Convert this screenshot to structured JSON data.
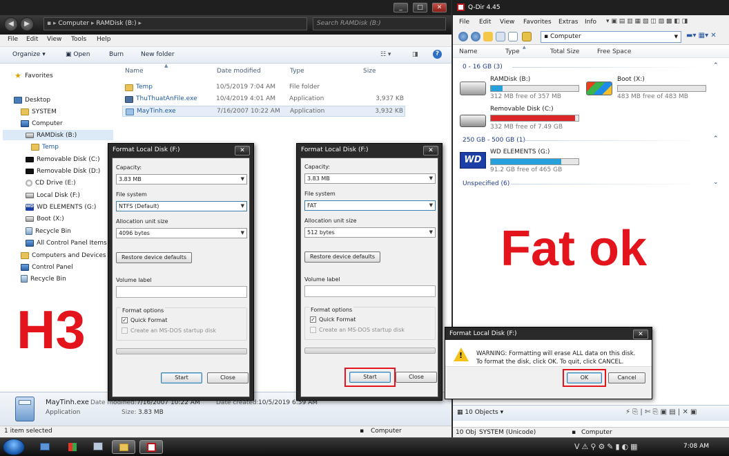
{
  "explorer": {
    "breadcrumb": [
      "Computer",
      "RAMDisk (B:)"
    ],
    "search_placeholder": "Search RAMDisk (B:)",
    "menu": [
      "File",
      "Edit",
      "View",
      "Tools",
      "Help"
    ],
    "toolbar": {
      "organize": "Organize",
      "open": "Open",
      "burn": "Burn",
      "new_folder": "New folder"
    },
    "columns": {
      "name": "Name",
      "date": "Date modified",
      "type": "Type",
      "size": "Size"
    },
    "files": [
      {
        "name": "Temp",
        "date": "10/5/2019 7:04 AM",
        "type": "File folder",
        "size": ""
      },
      {
        "name": "ThuThuatAnFile.exe",
        "date": "10/4/2019 4:01 AM",
        "type": "Application",
        "size": "3,937 KB"
      },
      {
        "name": "MayTinh.exe",
        "date": "7/16/2007 10:22 AM",
        "type": "Application",
        "size": "3,932 KB"
      }
    ],
    "nav": {
      "favorites": "Favorites",
      "desktop": "Desktop",
      "system": "SYSTEM",
      "computer": "Computer",
      "ramdisk": "RAMDisk (B:)",
      "temp": "Temp",
      "removable_c": "Removable Disk (C:)",
      "removable_d": "Removable Disk (D:)",
      "cd_drive": "CD Drive (E:)",
      "local_f": "Local Disk (F:)",
      "wd": "WD ELEMENTS (G:)",
      "boot": "Boot (X:)",
      "recycle_bin": "Recycle Bin",
      "all_cp": "All Control Panel Items",
      "computers_devices": "Computers and Devices",
      "control_panel": "Control Panel",
      "recycle_bin2": "Recycle Bin"
    },
    "details": {
      "name": "MayTinh.exe",
      "type": "Application",
      "date_modified_label": "Date modified:",
      "date_modified": "7/16/2007 10:22 AM",
      "date_created_label": "Date created:",
      "date_created": "10/5/2019 6:59 AM",
      "size_label": "Size:",
      "size": "3.83 MB"
    },
    "status_left": "1 item selected",
    "status_right": "Computer",
    "overlay_text": "H3"
  },
  "format_dialog_1": {
    "title": "Format Local Disk (F:)",
    "close": "✕",
    "capacity_label": "Capacity:",
    "capacity": "3.83 MB",
    "fs_label": "File system",
    "fs": "NTFS (Default)",
    "alloc_label": "Allocation unit size",
    "alloc": "4096 bytes",
    "restore": "Restore device defaults",
    "volume_label": "Volume label",
    "options_label": "Format options",
    "quick_format": "Quick Format",
    "msdos": "Create an MS-DOS startup disk",
    "start": "Start",
    "close_btn": "Close"
  },
  "format_dialog_2": {
    "title": "Format Local Disk (F:)",
    "close": "✕",
    "capacity_label": "Capacity:",
    "capacity": "3.83 MB",
    "fs_label": "File system",
    "fs": "FAT",
    "alloc_label": "Allocation unit size",
    "alloc": "512 bytes",
    "restore": "Restore device defaults",
    "volume_label": "Volume label",
    "options_label": "Format options",
    "quick_format": "Quick Format",
    "msdos": "Create an MS-DOS startup disk",
    "start": "Start",
    "close_btn": "Close"
  },
  "qdir": {
    "title": "Q-Dir 4.45",
    "menu": [
      "File",
      "Edit",
      "View",
      "Favorites",
      "Extras",
      "Info"
    ],
    "address": "Computer",
    "columns": {
      "name": "Name",
      "type": "Type",
      "total": "Total Size",
      "free": "Free Space"
    },
    "groups": [
      {
        "label": "0 - 16 GB (3)"
      },
      {
        "label": "250 GB - 500 GB (1)"
      },
      {
        "label": "Unspecified (6)"
      }
    ],
    "drives": [
      {
        "name": "RAMDisk (B:)",
        "free": "312 MB free of 357 MB",
        "used_fraction": 0.13,
        "bar_color": "#26a0da"
      },
      {
        "name": "Boot (X:)",
        "free": "483 MB free of 483 MB",
        "used_fraction": 0.0,
        "bar_color": "#26a0da"
      },
      {
        "name": "Removable Disk (C:)",
        "free": "332 MB free of 7.49 GB",
        "used_fraction": 0.96,
        "bar_color": "#da2626"
      },
      {
        "name": "WD ELEMENTS (G:)",
        "free": "91.2 GB free of 465 GB",
        "used_fraction": 0.8,
        "bar_color": "#26a0da"
      }
    ],
    "wd_logo": "WD",
    "objects": "10 Objects",
    "status_left": "10 Obj",
    "status_mid": "SYSTEM (Unicode)",
    "status_right": "Computer",
    "overlay_text": "Fat ok"
  },
  "warning": {
    "title": "Format Local Disk (F:)",
    "close": "✕",
    "message_line1": "WARNING: Formatting will erase ALL data on this disk.",
    "message_line2": "To format the disk, click OK. To quit, click CANCEL.",
    "ok": "OK",
    "cancel": "Cancel"
  },
  "taskbar": {
    "clock": "7:08 AM"
  }
}
